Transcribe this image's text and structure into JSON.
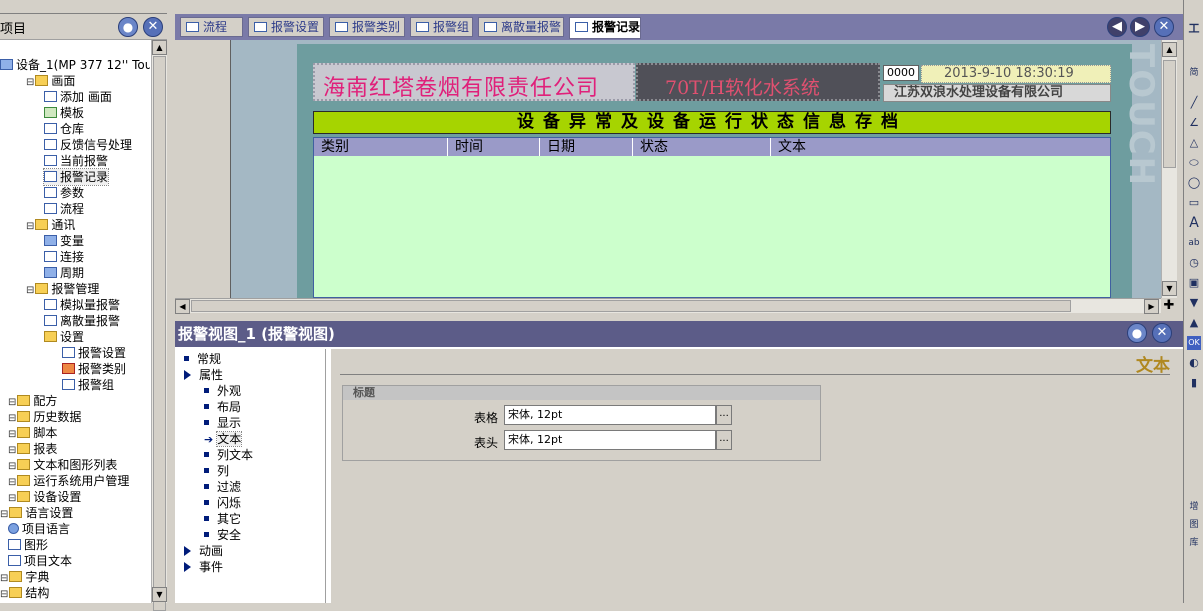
{
  "project_tree": {
    "title": "项目",
    "device": "设备_1(MP 377 12'' Touc",
    "items": [
      {
        "label": "画面",
        "level": 1,
        "icon": "folder-icon"
      },
      {
        "label": "添加 画面",
        "level": 2,
        "icon": "add-screen-icon"
      },
      {
        "label": "模板",
        "level": 2,
        "icon": "template-icon"
      },
      {
        "label": "仓库",
        "level": 2,
        "icon": "screen-icon"
      },
      {
        "label": "反馈信号处理",
        "level": 2,
        "icon": "screen-icon"
      },
      {
        "label": "当前报警",
        "level": 2,
        "icon": "screen-icon"
      },
      {
        "label": "报警记录",
        "level": 2,
        "icon": "screen-icon",
        "selected": true
      },
      {
        "label": "参数",
        "level": 2,
        "icon": "screen-icon"
      },
      {
        "label": "流程",
        "level": 2,
        "icon": "screen-icon"
      },
      {
        "label": "通讯",
        "level": 1,
        "icon": "folder-icon"
      },
      {
        "label": "变量",
        "level": 2,
        "icon": "tag-icon"
      },
      {
        "label": "连接",
        "level": 2,
        "icon": "connection-icon"
      },
      {
        "label": "周期",
        "level": 2,
        "icon": "cycle-icon"
      },
      {
        "label": "报警管理",
        "level": 1,
        "icon": "folder-icon"
      },
      {
        "label": "模拟量报警",
        "level": 2,
        "icon": "analog-alarm-icon"
      },
      {
        "label": "离散量报警",
        "level": 2,
        "icon": "discrete-alarm-icon"
      },
      {
        "label": "设置",
        "level": 2,
        "icon": "settings-icon"
      },
      {
        "label": "报警设置",
        "level": 3,
        "icon": "alarm-settings-icon"
      },
      {
        "label": "报警类别",
        "level": 3,
        "icon": "alarm-class-icon"
      },
      {
        "label": "报警组",
        "level": 3,
        "icon": "alarm-group-icon"
      },
      {
        "label": "配方",
        "level": 0,
        "icon": "folder-icon"
      },
      {
        "label": "历史数据",
        "level": 0,
        "icon": "folder-icon"
      },
      {
        "label": "脚本",
        "level": 0,
        "icon": "folder-icon"
      },
      {
        "label": "报表",
        "level": 0,
        "icon": "folder-icon"
      },
      {
        "label": "文本和图形列表",
        "level": 0,
        "icon": "folder-icon"
      },
      {
        "label": "运行系统用户管理",
        "level": 0,
        "icon": "folder-icon"
      },
      {
        "label": "设备设置",
        "level": 0,
        "icon": "folder-icon"
      },
      {
        "label": "语言设置",
        "level": -1,
        "icon": "folder-icon"
      },
      {
        "label": "项目语言",
        "level": 0,
        "icon": "language-icon"
      },
      {
        "label": "图形",
        "level": 0,
        "icon": "graphics-icon"
      },
      {
        "label": "项目文本",
        "level": 0,
        "icon": "text-icon"
      },
      {
        "label": "字典",
        "level": -1,
        "icon": "folder-icon"
      },
      {
        "label": "结构",
        "level": -1,
        "icon": "folder-icon"
      }
    ]
  },
  "tabs": [
    {
      "label": "流程",
      "active": false
    },
    {
      "label": "报警设置",
      "active": false
    },
    {
      "label": "报警类别",
      "active": false
    },
    {
      "label": "报警组",
      "active": false
    },
    {
      "label": "离散量报警",
      "active": false
    },
    {
      "label": "报警记录",
      "active": true
    }
  ],
  "screen": {
    "company": "海南红塔卷烟有限责任公司",
    "system": "70T/H软化水系统",
    "counter": "0000",
    "datetime": "2013-9-10 18:30:19",
    "supplier": "江苏双浪水处理设备有限公司",
    "banner": "设备异常及设备运行状态信息存档",
    "columns": [
      "类别",
      "时间",
      "日期",
      "状态",
      "文本"
    ],
    "side_logo": "TOUCH"
  },
  "properties": {
    "title": "报警视图_1 (报警视图)",
    "heading": "文本",
    "group_label": "标题",
    "fields": [
      {
        "label": "表格",
        "value": "宋体, 12pt"
      },
      {
        "label": "表头",
        "value": "宋体, 12pt"
      }
    ],
    "tree": [
      {
        "label": "常规",
        "type": "bullet",
        "level": 0
      },
      {
        "label": "属性",
        "type": "expand",
        "level": 0
      },
      {
        "label": "外观",
        "type": "bullet",
        "level": 1
      },
      {
        "label": "布局",
        "type": "bullet",
        "level": 1
      },
      {
        "label": "显示",
        "type": "bullet",
        "level": 1
      },
      {
        "label": "文本",
        "type": "arrow",
        "level": 1,
        "selected": true
      },
      {
        "label": "列文本",
        "type": "bullet",
        "level": 1
      },
      {
        "label": "列",
        "type": "bullet",
        "level": 1
      },
      {
        "label": "过滤",
        "type": "bullet",
        "level": 1
      },
      {
        "label": "闪烁",
        "type": "bullet",
        "level": 1
      },
      {
        "label": "其它",
        "type": "bullet",
        "level": 1
      },
      {
        "label": "安全",
        "type": "bullet",
        "level": 1
      },
      {
        "label": "动画",
        "type": "expand",
        "level": 0
      },
      {
        "label": "事件",
        "type": "expand",
        "level": 0
      }
    ]
  },
  "toolbox": {
    "items": [
      "line-icon",
      "polyline-icon",
      "polygon-icon",
      "ellipse-icon",
      "circle-icon",
      "rectangle-icon",
      "text-icon",
      "io-field-icon",
      "datetime-icon",
      "graphic-io-icon",
      "symbolic-io-icon",
      "graphic-view-icon",
      "button-icon",
      "switch-icon",
      "bar-icon"
    ],
    "labels": [
      "工",
      "简",
      "A",
      "ab",
      "OK",
      "增",
      "图",
      "库"
    ]
  },
  "colors": {
    "accent": "#5c5c88",
    "tab_bar": "#7a7aa8",
    "banner": "#a6d400",
    "alarm_bg": "#ccffcc"
  }
}
